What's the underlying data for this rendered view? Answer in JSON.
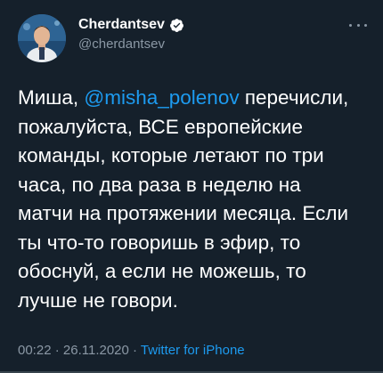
{
  "author": {
    "display_name": "Cherdantsev",
    "handle": "@cherdantsev",
    "verified": true
  },
  "tweet": {
    "lines": [
      {
        "before": "Миша, ",
        "mention": "@misha_polenov",
        "after": " перечисли,"
      },
      {
        "text": "пожалуйста, ВСЕ европейские"
      },
      {
        "text": "команды, которые летают по три"
      },
      {
        "text": "часа, по два раза в неделю на"
      },
      {
        "text": "матчи на протяжении месяца. Если"
      },
      {
        "text": "ты что-то говоришь в эфир, то"
      },
      {
        "text": "обоснуй, а если не можешь, то"
      },
      {
        "text": "лучше не говори."
      }
    ]
  },
  "meta": {
    "time": "00:22",
    "separator": " · ",
    "date": "26.11.2020",
    "source": "Twitter for iPhone"
  },
  "colors": {
    "background": "#15202b",
    "accent": "#1d9bf0",
    "secondary_text": "#8b98a5"
  },
  "icons": {
    "verified": "verified-badge-icon",
    "more": "more-options-icon"
  }
}
